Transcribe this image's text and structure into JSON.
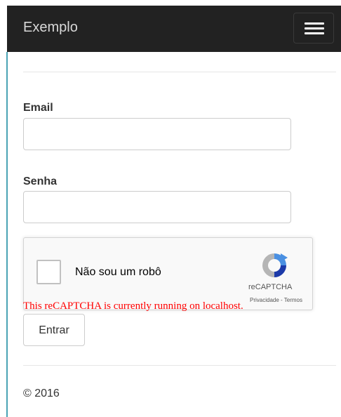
{
  "navbar": {
    "brand": "Exemplo",
    "toggle_icon": "hamburger-menu-icon"
  },
  "form": {
    "email_label": "Email",
    "email_value": "",
    "password_label": "Senha",
    "password_value": "",
    "submit_label": "Entrar"
  },
  "recaptcha": {
    "checkbox_label": "Não sou um robô",
    "brand": "reCAPTCHA",
    "terms": "Privacidade - Termos",
    "warning": "This reCAPTCHA is currently running on localhost.",
    "logo_icon": "recaptcha-logo-icon",
    "colors": {
      "warning": "#ff0000",
      "logo_blue": "#4a90e2",
      "logo_dark": "#1c3aa9",
      "logo_gray": "#b5b5b5"
    }
  },
  "footer": {
    "copyright": "© 2016"
  },
  "colors": {
    "navbar_bg": "#222222",
    "accent_rule": "#4aa3b5"
  }
}
